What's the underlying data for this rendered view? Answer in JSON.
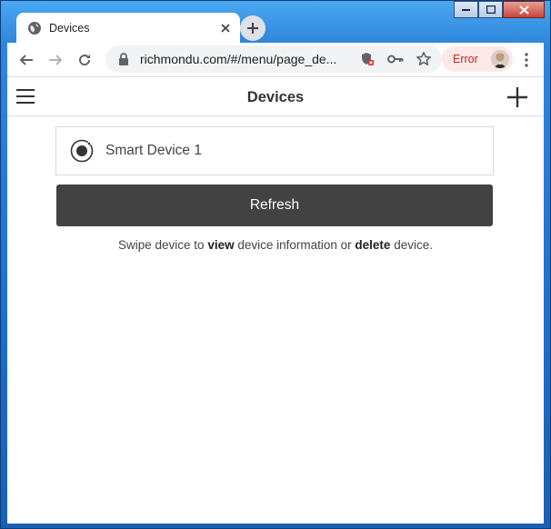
{
  "browser": {
    "tab_title": "Devices",
    "url": "richmondu.com/#/menu/page_de...",
    "error_label": "Error"
  },
  "app": {
    "title": "Devices",
    "devices": [
      {
        "name": "Smart Device 1"
      }
    ],
    "refresh_label": "Refresh",
    "hint": {
      "prefix": "Swipe device to ",
      "view": "view",
      "middle": " device information or ",
      "delete": "delete",
      "suffix": " device."
    }
  },
  "icons": {
    "tab": "globe-icon",
    "nav": [
      "back-arrow-icon",
      "forward-arrow-icon",
      "reload-icon"
    ],
    "omnibox": [
      "lock-icon",
      "blocked-content-icon",
      "key-icon",
      "star-icon"
    ],
    "app": [
      "hamburger-icon",
      "plus-icon",
      "radio-icon"
    ]
  },
  "colors": {
    "refresh_bg": "#424242",
    "error_pill_bg": "#fce8e6",
    "error_text": "#c5221f"
  }
}
